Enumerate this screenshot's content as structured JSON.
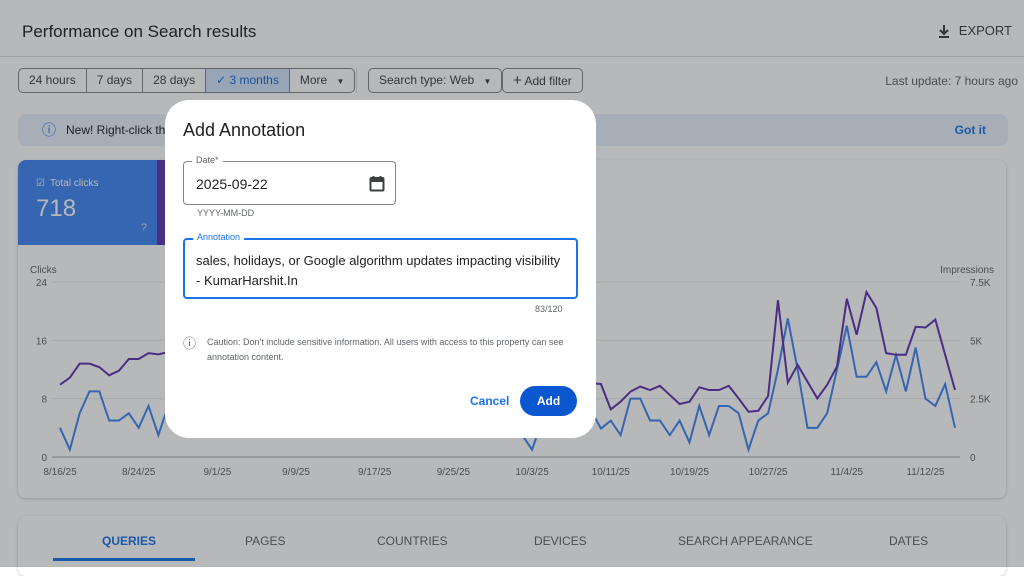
{
  "header": {
    "title": "Performance on Search results",
    "export_label": "EXPORT"
  },
  "filters": {
    "ranges": [
      "24 hours",
      "7 days",
      "28 days",
      "3 months",
      "More"
    ],
    "selected": "3 months",
    "search_type": "Search type: Web",
    "add_filter": "Add filter",
    "last_update": "Last update: 7 hours ago"
  },
  "banner": {
    "text": "New! Right-click the",
    "dismiss": "Got it"
  },
  "metrics": {
    "clicks_label": "Total clicks",
    "clicks_value": "718"
  },
  "tabs": [
    "QUERIES",
    "PAGES",
    "COUNTRIES",
    "DEVICES",
    "SEARCH APPEARANCE",
    "DATES"
  ],
  "colors": {
    "clicks": "#4285f4",
    "impressions": "#5e35b1",
    "accent": "#1a73e8"
  },
  "dialog": {
    "title": "Add Annotation",
    "date_label": "Date*",
    "date_value": "2025-09-22",
    "date_hint": "YYYY-MM-DD",
    "annotation_label": "Annotation",
    "annotation_value": "sales, holidays, or Google algorithm updates impacting visibility - KumarHarshit.In",
    "char_count": "83/120",
    "caution": "Caution: Don't include sensitive information. All users with access to this property can see annotation content.",
    "cancel": "Cancel",
    "add": "Add"
  },
  "chart_data": {
    "type": "line",
    "start_date": "2025-08-16",
    "days": 92,
    "x_tick_labels": [
      "8/16/25",
      "8/24/25",
      "9/1/25",
      "9/9/25",
      "9/17/25",
      "9/25/25",
      "10/3/25",
      "10/11/25",
      "10/19/25",
      "10/27/25",
      "11/4/25",
      "11/12/25"
    ],
    "left_axis": {
      "label": "Clicks",
      "ticks": [
        "24",
        "16",
        "8",
        "0"
      ],
      "range": [
        0,
        24
      ]
    },
    "right_axis": {
      "label": "Impressions",
      "ticks": [
        "7.5K",
        "5K",
        "2.5K",
        "0"
      ],
      "range": [
        0,
        7.5
      ]
    },
    "series": [
      {
        "name": "Clicks",
        "axis": "left",
        "values": [
          4,
          1,
          6,
          9,
          9,
          5,
          5,
          6,
          4,
          7,
          3,
          7,
          6,
          5,
          4,
          7,
          5,
          6,
          3,
          5,
          6,
          7,
          4,
          5,
          6,
          5,
          3,
          6,
          7,
          5,
          4,
          6,
          5,
          7,
          4,
          5,
          6,
          3,
          5,
          6,
          4,
          7,
          5,
          6,
          5,
          4,
          6,
          3,
          1,
          5,
          6,
          4,
          5,
          7,
          6.4,
          3.9,
          5,
          3,
          8,
          8,
          5,
          5,
          3,
          5,
          2,
          7,
          3,
          7,
          7,
          6,
          1,
          5,
          6,
          12,
          19,
          12,
          4,
          4,
          6,
          12,
          18,
          11,
          11,
          13,
          9,
          14,
          9,
          15,
          8,
          7,
          10,
          4
        ]
      },
      {
        "name": "Impressions (K)",
        "axis": "right",
        "values": [
          3.1,
          3.4,
          4.0,
          4.0,
          3.85,
          3.5,
          3.7,
          4.2,
          4.2,
          4.45,
          4.4,
          4.5,
          4.4,
          4.3,
          4.1,
          4.5,
          4.2,
          4.0,
          3.8,
          4.1,
          4.3,
          4.4,
          3.9,
          4.0,
          4.2,
          4.1,
          3.7,
          3.9,
          4.2,
          4.0,
          3.8,
          4.1,
          3.9,
          4.2,
          3.7,
          3.8,
          4.0,
          3.5,
          3.7,
          3.9,
          3.6,
          3.8,
          3.5,
          3.7,
          3.4,
          3.3,
          3.5,
          3.2,
          2.9,
          3.1,
          3.3,
          3.0,
          3.2,
          3.3,
          3.16,
          3.13,
          2.04,
          2.37,
          2.8,
          3.02,
          2.87,
          3.05,
          2.66,
          2.27,
          2.37,
          2.99,
          2.87,
          2.87,
          3.05,
          2.51,
          1.94,
          1.98,
          2.62,
          6.72,
          3.19,
          3.95,
          3.23,
          2.51,
          3.09,
          3.88,
          6.78,
          5.24,
          7.07,
          6.39,
          4.45,
          4.38,
          4.38,
          5.58,
          5.55,
          5.89,
          4.38,
          2.87
        ]
      }
    ]
  }
}
